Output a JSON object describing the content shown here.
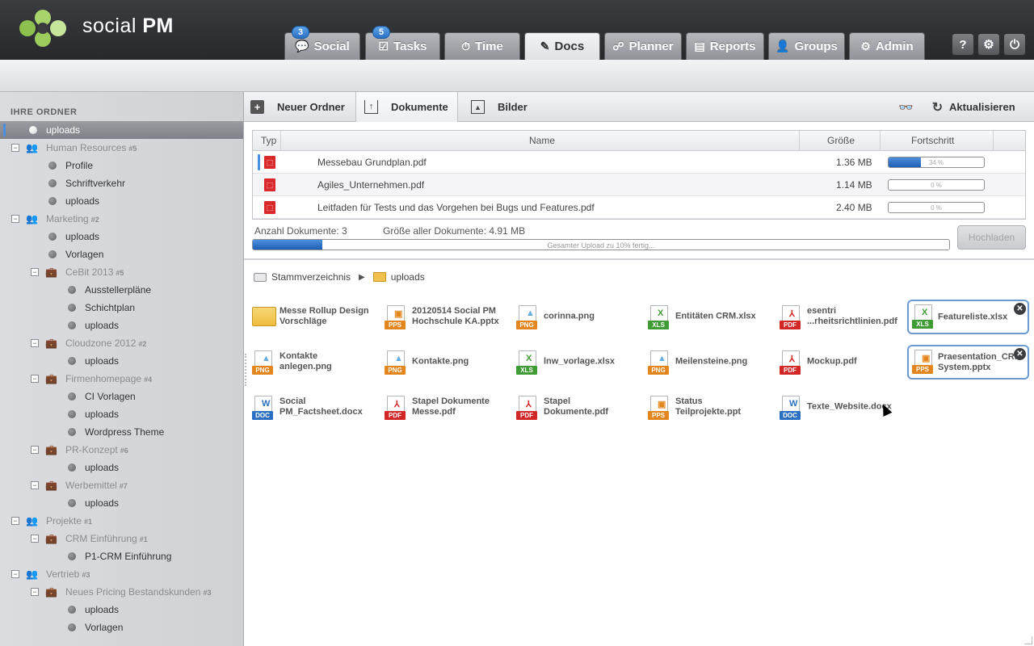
{
  "app": {
    "logo_text_regular": "social",
    "logo_text_bold": "PM"
  },
  "nav": {
    "tabs": [
      {
        "label": "Social",
        "badge": "3",
        "icon": "speech-bubble-icon"
      },
      {
        "label": "Tasks",
        "badge": "5",
        "icon": "checkbox-icon"
      },
      {
        "label": "Time",
        "icon": "stopwatch-icon"
      },
      {
        "label": "Docs",
        "icon": "edit-icon",
        "active": true
      },
      {
        "label": "Planner",
        "icon": "nodes-icon"
      },
      {
        "label": "Reports",
        "icon": "presentation-icon"
      },
      {
        "label": "Groups",
        "icon": "person-icon"
      },
      {
        "label": "Admin",
        "icon": "gear-icon"
      }
    ],
    "tools": {
      "help": "?",
      "settings": "⚙",
      "power": "⏻"
    }
  },
  "sidebar": {
    "title": "IHRE ORDNER",
    "items": [
      {
        "label": "uploads",
        "count": "",
        "type": "folder",
        "selected": true
      },
      {
        "label": "Human Resources",
        "count": "#5",
        "type": "group"
      },
      {
        "label": "Profile",
        "count": "",
        "type": "folder"
      },
      {
        "label": "Schriftverkehr",
        "count": "",
        "type": "folder"
      },
      {
        "label": "uploads",
        "count": "",
        "type": "folder"
      },
      {
        "label": "Marketing",
        "count": "#2",
        "type": "group"
      },
      {
        "label": "uploads",
        "count": "",
        "type": "folder"
      },
      {
        "label": "Vorlagen",
        "count": "",
        "type": "folder"
      },
      {
        "label": "CeBit 2013",
        "count": "#5",
        "type": "project"
      },
      {
        "label": "Ausstellerpläne",
        "count": "",
        "type": "folder"
      },
      {
        "label": "Schichtplan",
        "count": "",
        "type": "folder"
      },
      {
        "label": "uploads",
        "count": "",
        "type": "folder"
      },
      {
        "label": "Cloudzone 2012",
        "count": "#2",
        "type": "project"
      },
      {
        "label": "uploads",
        "count": "",
        "type": "folder"
      },
      {
        "label": "Firmenhomepage",
        "count": "#4",
        "type": "project"
      },
      {
        "label": "CI Vorlagen",
        "count": "",
        "type": "folder"
      },
      {
        "label": "uploads",
        "count": "",
        "type": "folder"
      },
      {
        "label": "Wordpress Theme",
        "count": "",
        "type": "folder"
      },
      {
        "label": "PR-Konzept",
        "count": "#6",
        "type": "project"
      },
      {
        "label": "uploads",
        "count": "",
        "type": "folder"
      },
      {
        "label": "Werbemittel",
        "count": "#7",
        "type": "project"
      },
      {
        "label": "uploads",
        "count": "",
        "type": "folder"
      },
      {
        "label": "Projekte",
        "count": "#1",
        "type": "group"
      },
      {
        "label": "CRM Einführung",
        "count": "#1",
        "type": "project"
      },
      {
        "label": "P1-CRM Einführung",
        "count": "",
        "type": "folder"
      },
      {
        "label": "Vertrieb",
        "count": "#3",
        "type": "group"
      },
      {
        "label": "Neues Pricing Bestandskunden",
        "count": "#3",
        "type": "project"
      },
      {
        "label": "uploads",
        "count": "",
        "type": "folder"
      },
      {
        "label": "Vorlagen",
        "count": "",
        "type": "folder"
      }
    ]
  },
  "toolbar": {
    "new_folder": "Neuer Ordner",
    "documents": "Dokumente",
    "images": "Bilder",
    "refresh": "Aktualisieren"
  },
  "uploads": {
    "columns": {
      "type": "Typ",
      "name": "Name",
      "size": "Größe",
      "progress": "Fortschritt"
    },
    "rows": [
      {
        "name": "Messebau Grundplan.pdf",
        "size": "1.36 MB",
        "progress": 0.34,
        "progress_label": "34 %"
      },
      {
        "name": "Agiles_Unternehmen.pdf",
        "size": "1.14 MB",
        "progress": 0,
        "progress_label": "0 %"
      },
      {
        "name": "Leitfaden für Tests und das Vorgehen bei Bugs und Features.pdf",
        "size": "2.40 MB",
        "progress": 0,
        "progress_label": "0 %"
      }
    ],
    "count_label": "Anzahl Dokumente: 3",
    "total_size_label": "Größe aller Dokumente: 4.91 MB",
    "total_progress": 0.1,
    "total_progress_label": "Gesamter Upload zu 10% fertig...",
    "upload_button": "Hochladen"
  },
  "breadcrumb": {
    "root": "Stammverzeichnis",
    "current": "uploads"
  },
  "files": [
    {
      "name": "Messe Rollup Design Vorschläge",
      "type": "folder"
    },
    {
      "name": "20120514 Social PM Hochschule KA.pptx",
      "type": "pps"
    },
    {
      "name": "corinna.png",
      "type": "png"
    },
    {
      "name": "Entitäten CRM.xlsx",
      "type": "xls"
    },
    {
      "name": "esentri ...rheitsrichtlinien.pdf",
      "type": "pdf"
    },
    {
      "name": "Featureliste.xlsx",
      "type": "xls",
      "selected": true
    },
    {
      "name": "Kontakte anlegen.png",
      "type": "png"
    },
    {
      "name": "Kontakte.png",
      "type": "png"
    },
    {
      "name": "lnw_vorlage.xlsx",
      "type": "xls"
    },
    {
      "name": "Meilensteine.png",
      "type": "png"
    },
    {
      "name": "Mockup.pdf",
      "type": "pdf"
    },
    {
      "name": "Praesentation_CRM-System.pptx",
      "type": "pps",
      "selected": true
    },
    {
      "name": "Social PM_Factsheet.docx",
      "type": "doc"
    },
    {
      "name": "Stapel Dokumente Messe.pdf",
      "type": "pdf"
    },
    {
      "name": "Stapel Dokumente.pdf",
      "type": "pdf"
    },
    {
      "name": "Status Teilprojekte.ppt",
      "type": "pps"
    },
    {
      "name": "Texte_Website.docx",
      "type": "doc"
    }
  ],
  "badge_labels": {
    "pdf": "PDF",
    "xls": "XLS",
    "png": "PNG",
    "pps": "PPS",
    "doc": "DOC"
  }
}
